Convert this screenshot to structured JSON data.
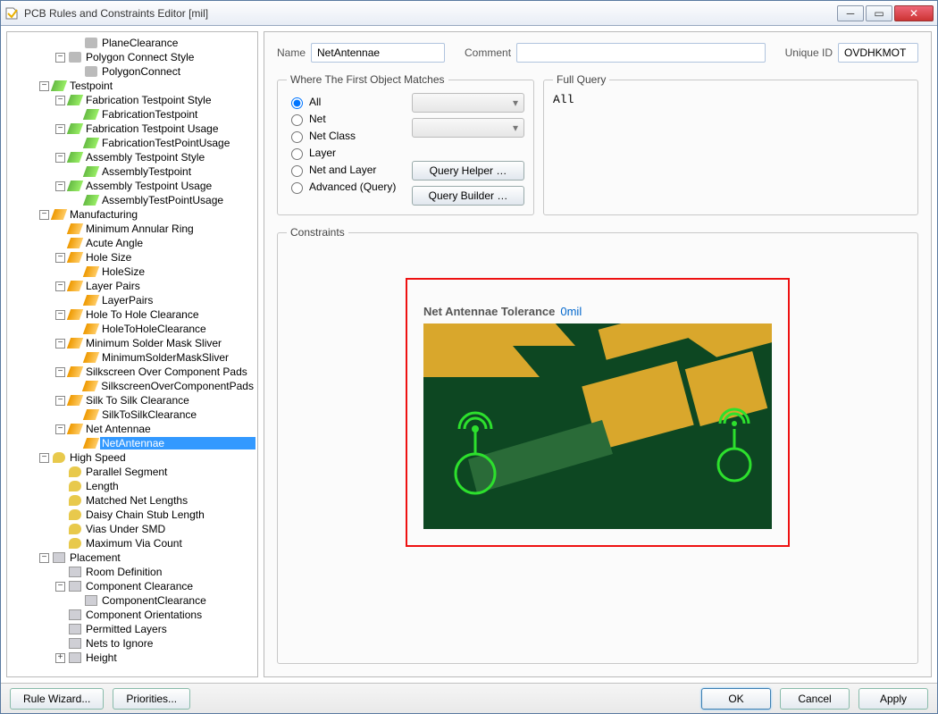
{
  "window": {
    "title": "PCB Rules and Constraints Editor [mil]"
  },
  "tree": [
    {
      "d": 4,
      "exp": "",
      "ic": "plane",
      "t": "PlaneClearance"
    },
    {
      "d": 3,
      "exp": "-",
      "ic": "plane",
      "t": "Polygon Connect Style"
    },
    {
      "d": 4,
      "exp": "",
      "ic": "plane",
      "t": "PolygonConnect"
    },
    {
      "d": 2,
      "exp": "-",
      "ic": "green",
      "t": "Testpoint"
    },
    {
      "d": 3,
      "exp": "-",
      "ic": "green",
      "t": "Fabrication Testpoint Style"
    },
    {
      "d": 4,
      "exp": "",
      "ic": "green",
      "t": "FabricationTestpoint"
    },
    {
      "d": 3,
      "exp": "-",
      "ic": "green",
      "t": "Fabrication Testpoint Usage"
    },
    {
      "d": 4,
      "exp": "",
      "ic": "green",
      "t": "FabricationTestPointUsage"
    },
    {
      "d": 3,
      "exp": "-",
      "ic": "green",
      "t": "Assembly Testpoint Style"
    },
    {
      "d": 4,
      "exp": "",
      "ic": "green",
      "t": "AssemblyTestpoint"
    },
    {
      "d": 3,
      "exp": "-",
      "ic": "green",
      "t": "Assembly Testpoint Usage"
    },
    {
      "d": 4,
      "exp": "",
      "ic": "green",
      "t": "AssemblyTestPointUsage"
    },
    {
      "d": 2,
      "exp": "-",
      "ic": "orange",
      "t": "Manufacturing"
    },
    {
      "d": 3,
      "exp": "",
      "ic": "orange",
      "t": "Minimum Annular Ring"
    },
    {
      "d": 3,
      "exp": "",
      "ic": "orange",
      "t": "Acute Angle"
    },
    {
      "d": 3,
      "exp": "-",
      "ic": "orange",
      "t": "Hole Size"
    },
    {
      "d": 4,
      "exp": "",
      "ic": "orange",
      "t": "HoleSize"
    },
    {
      "d": 3,
      "exp": "-",
      "ic": "orange",
      "t": "Layer Pairs"
    },
    {
      "d": 4,
      "exp": "",
      "ic": "orange",
      "t": "LayerPairs"
    },
    {
      "d": 3,
      "exp": "-",
      "ic": "orange",
      "t": "Hole To Hole Clearance"
    },
    {
      "d": 4,
      "exp": "",
      "ic": "orange",
      "t": "HoleToHoleClearance"
    },
    {
      "d": 3,
      "exp": "-",
      "ic": "orange",
      "t": "Minimum Solder Mask Sliver"
    },
    {
      "d": 4,
      "exp": "",
      "ic": "orange",
      "t": "MinimumSolderMaskSliver"
    },
    {
      "d": 3,
      "exp": "-",
      "ic": "orange",
      "t": "Silkscreen Over Component Pads"
    },
    {
      "d": 4,
      "exp": "",
      "ic": "orange",
      "t": "SilkscreenOverComponentPads"
    },
    {
      "d": 3,
      "exp": "-",
      "ic": "orange",
      "t": "Silk To Silk Clearance"
    },
    {
      "d": 4,
      "exp": "",
      "ic": "orange",
      "t": "SilkToSilkClearance"
    },
    {
      "d": 3,
      "exp": "-",
      "ic": "orange",
      "t": "Net Antennae"
    },
    {
      "d": 4,
      "exp": "",
      "ic": "orange",
      "t": "NetAntennae",
      "sel": true
    },
    {
      "d": 2,
      "exp": "-",
      "ic": "yellow",
      "t": "High Speed"
    },
    {
      "d": 3,
      "exp": "",
      "ic": "yellow",
      "t": "Parallel Segment"
    },
    {
      "d": 3,
      "exp": "",
      "ic": "yellow",
      "t": "Length"
    },
    {
      "d": 3,
      "exp": "",
      "ic": "yellow",
      "t": "Matched Net Lengths"
    },
    {
      "d": 3,
      "exp": "",
      "ic": "yellow",
      "t": "Daisy Chain Stub Length"
    },
    {
      "d": 3,
      "exp": "",
      "ic": "yellow",
      "t": "Vias Under SMD"
    },
    {
      "d": 3,
      "exp": "",
      "ic": "yellow",
      "t": "Maximum Via Count"
    },
    {
      "d": 2,
      "exp": "-",
      "ic": "page",
      "t": "Placement"
    },
    {
      "d": 3,
      "exp": "",
      "ic": "page",
      "t": "Room Definition"
    },
    {
      "d": 3,
      "exp": "-",
      "ic": "page",
      "t": "Component Clearance"
    },
    {
      "d": 4,
      "exp": "",
      "ic": "page",
      "t": "ComponentClearance"
    },
    {
      "d": 3,
      "exp": "",
      "ic": "page",
      "t": "Component Orientations"
    },
    {
      "d": 3,
      "exp": "",
      "ic": "page",
      "t": "Permitted Layers"
    },
    {
      "d": 3,
      "exp": "",
      "ic": "page",
      "t": "Nets to Ignore"
    },
    {
      "d": 3,
      "exp": "+",
      "ic": "page",
      "t": "Height"
    }
  ],
  "form": {
    "nameLabel": "Name",
    "nameValue": "NetAntennae",
    "commentLabel": "Comment",
    "commentValue": "",
    "uidLabel": "Unique ID",
    "uidValue": "OVDHKMOT"
  },
  "matches": {
    "legend": "Where The First Object Matches",
    "options": [
      "All",
      "Net",
      "Net Class",
      "Layer",
      "Net and Layer",
      "Advanced (Query)"
    ],
    "selected": 0,
    "queryHelper": "Query Helper …",
    "queryBuilder": "Query Builder …"
  },
  "fullQuery": {
    "legend": "Full Query",
    "text": "All"
  },
  "constraints": {
    "legend": "Constraints",
    "tolLabel": "Net Antennae Tolerance",
    "tolValue": "0mil"
  },
  "buttons": {
    "ruleWizard": "Rule Wizard...",
    "priorities": "Priorities...",
    "ok": "OK",
    "cancel": "Cancel",
    "apply": "Apply"
  }
}
